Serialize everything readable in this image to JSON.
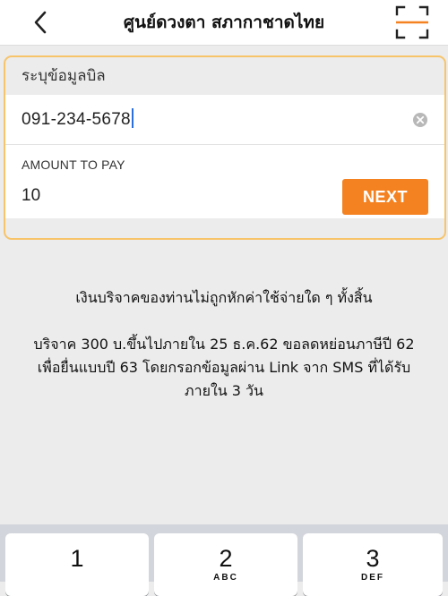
{
  "header": {
    "title": "ศูนย์ดวงตา สภากาชาดไทย",
    "back_icon": "chevron-left-icon",
    "scan_icon": "scan-frame-icon"
  },
  "form": {
    "heading": "ระบุข้อมูลบิล",
    "phone_value": "091-234-5678",
    "clear_icon": "clear-circle-icon",
    "amount_label": "AMOUNT TO PAY",
    "amount_value": "10",
    "next_label": "NEXT",
    "accent_color": "#f58220",
    "highlight_border_color": "#f7c46a"
  },
  "notice": {
    "line1": "เงินบริจาคของท่านไม่ถูกหักค่าใช้จ่ายใด ๆ ทั้งสิ้น",
    "line2": "บริจาค 300 บ.ขึ้นไปภายใน 25 ธ.ค.62 ขอลดหย่อนภาษีปี 62",
    "line3": "เพื่อยื่นแบบปี 63 โดยกรอกข้อมูลผ่าน Link จาก SMS ที่ได้รับ",
    "line4": "ภายใน 3 วัน"
  },
  "keypad": {
    "keys": [
      {
        "num": "1",
        "letters": ""
      },
      {
        "num": "2",
        "letters": "ABC"
      },
      {
        "num": "3",
        "letters": "DEF"
      }
    ]
  }
}
